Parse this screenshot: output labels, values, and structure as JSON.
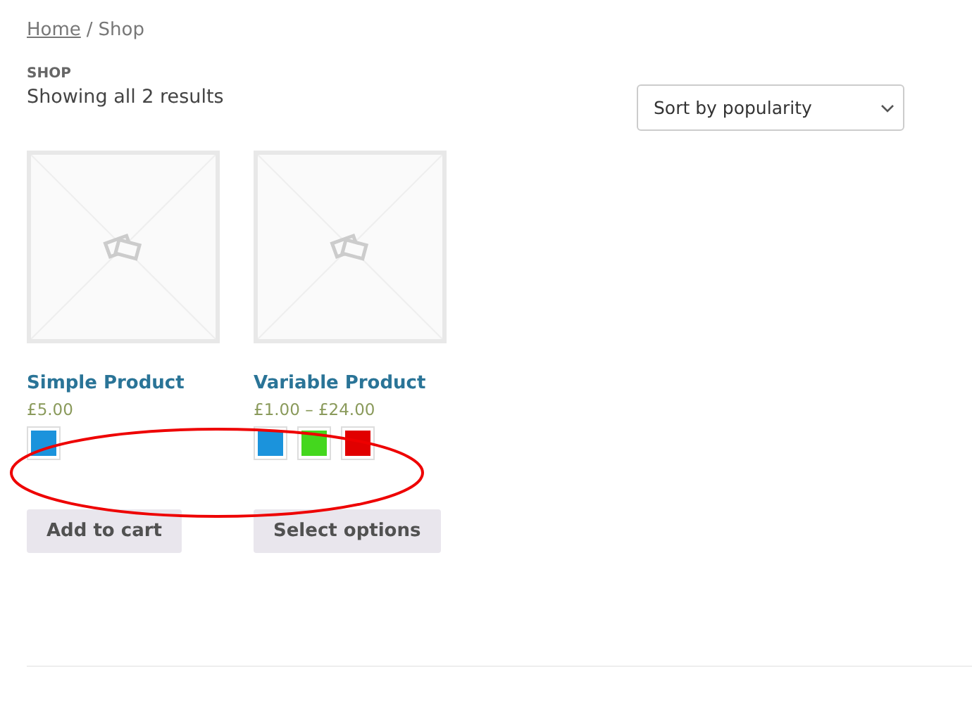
{
  "breadcrumb": {
    "link": "Home",
    "separator": "/",
    "current": "Shop"
  },
  "page_title": "SHOP",
  "result_count": "Showing all 2 results",
  "sort_select": {
    "value": "Sort by popularity"
  },
  "products": [
    {
      "name": "Simple Product",
      "price": "£5.00",
      "swatches": [
        {
          "color": "#1b93dc"
        }
      ],
      "button": "Add to cart"
    },
    {
      "name": "Variable Product",
      "price": "£1.00 – £24.00",
      "swatches": [
        {
          "color": "#1b93dc"
        },
        {
          "color": "#44d71e"
        },
        {
          "color": "#e10000"
        }
      ],
      "button": "Select options"
    }
  ],
  "annotation": {
    "kind": "ellipse"
  }
}
